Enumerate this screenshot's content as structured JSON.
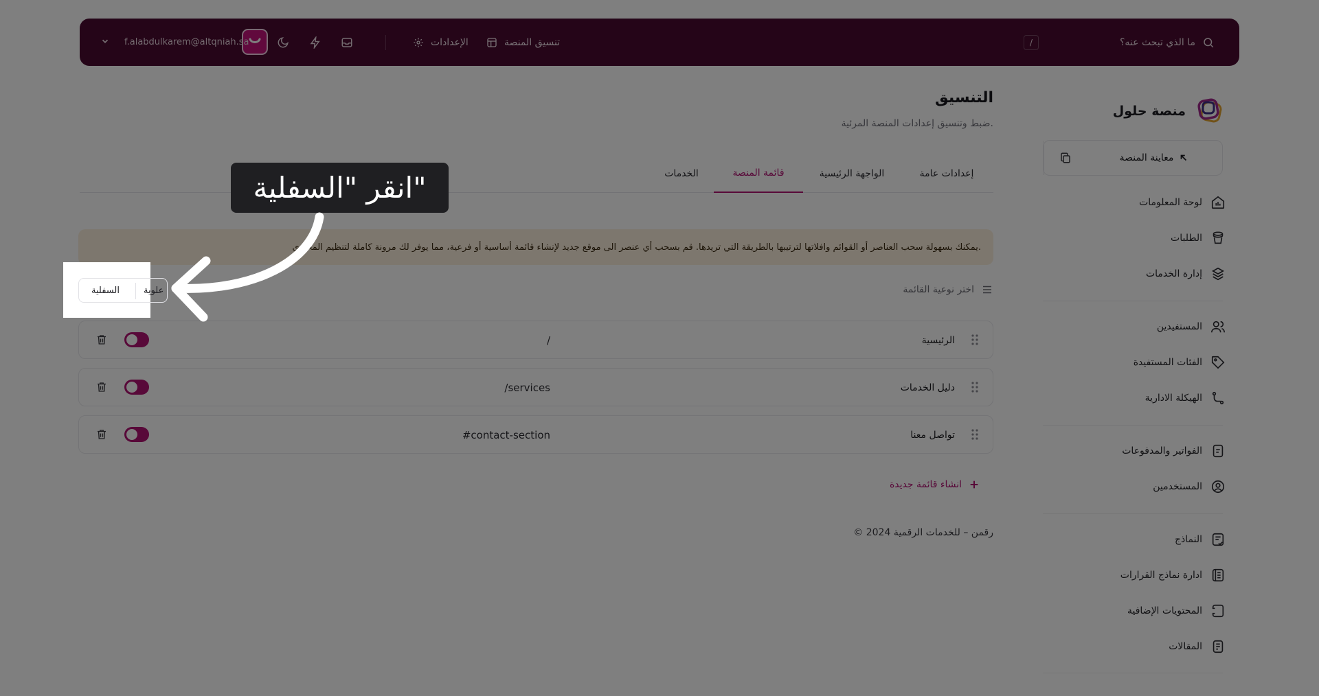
{
  "topbar": {
    "search_placeholder": "ما الذي تبحث عنه؟",
    "search_shortcut": "/",
    "platform_link": "تنسيق المنصة",
    "settings_link": "الإعدادات",
    "user_email": "f.alabdulkarem@altqniah.sa"
  },
  "sidebar": {
    "brand": "منصة حلول",
    "preview_button": "معاينة المنصة",
    "items": [
      {
        "label": "لوحة المعلومات",
        "icon": "dashboard-icon"
      },
      {
        "label": "الطلبات",
        "icon": "orders-icon"
      },
      {
        "label": "إدارة الخدمات",
        "icon": "services-icon"
      },
      {
        "label": "المستفيدين",
        "icon": "users-icon"
      },
      {
        "label": "الفئات المستفيدة",
        "icon": "tag-icon"
      },
      {
        "label": "الهيكلة الادارية",
        "icon": "hierarchy-icon"
      },
      {
        "label": "الفواتير والمدفوعات",
        "icon": "invoice-icon"
      },
      {
        "label": "المستخدمين",
        "icon": "user-circle-icon"
      },
      {
        "label": "النماذج",
        "icon": "forms-icon"
      },
      {
        "label": "ادارة نماذج القرارات",
        "icon": "decisions-icon"
      },
      {
        "label": "المحتويات الإضافية",
        "icon": "content-icon"
      },
      {
        "label": "المقالات",
        "icon": "articles-icon"
      }
    ]
  },
  "main": {
    "title": "التنسيق",
    "subtitle": "ضبط وتنسيق إعدادات المنصة المرئية.",
    "tabs": [
      {
        "label": "إعدادات عامة"
      },
      {
        "label": "الواجهة الرئيسية"
      },
      {
        "label": "قائمة المنصة"
      },
      {
        "label": "الخدمات"
      }
    ],
    "alert": "يمكنك بسهولة سحب العناصر أو القوائم وافلاتها لترتيبها بالطريقة التي تريدها. قم بسحب أي عنصر الى موقع جديد لإنشاء قائمة أساسية أو فرعية، مما يوفر لك مرونة كاملة لتنظيم المحتوى.",
    "menu_type_label": "اختر نوعية القائمة",
    "menu_rows": [
      {
        "name": "الرئيسية",
        "path": "/"
      },
      {
        "name": "دليل الخدمات",
        "path": "/services"
      },
      {
        "name": "تواصل معنا",
        "path": "#contact-section"
      }
    ],
    "create_menu": "انشاء قائمة جديدة",
    "copyright": "© 2024 رقمن – للخدمات الرقمية"
  },
  "tutorial": {
    "callout": "انقر \"السفلية\"",
    "highlight_label": "السفلية",
    "highlight_partial": "علوية"
  },
  "colors": {
    "topbar": "#4a0b31",
    "accent": "#b01272",
    "alert_bg": "#fbefdc"
  }
}
